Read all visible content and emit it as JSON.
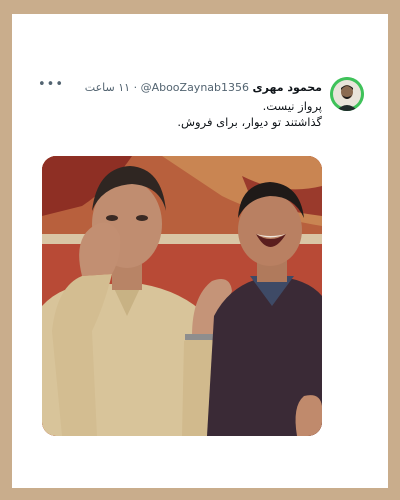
{
  "tweet": {
    "author_name": "محمود مهری",
    "handle": "@AbooZaynab1356",
    "time": "۱۱ ساعت",
    "separator": "·",
    "more_icon": "more-horizontal-icon",
    "text_lines": [
      "پرواز نیست.",
      "گذاشتند تو دیوار، برای فروش."
    ],
    "media": {
      "kind": "photo",
      "description_icon": "photo"
    }
  },
  "colors": {
    "background": "#c9ad8c",
    "card": "#ffffff",
    "avatar_ring": "#3fc25a",
    "secondary_text": "#536471",
    "primary_text": "#0f1419"
  }
}
